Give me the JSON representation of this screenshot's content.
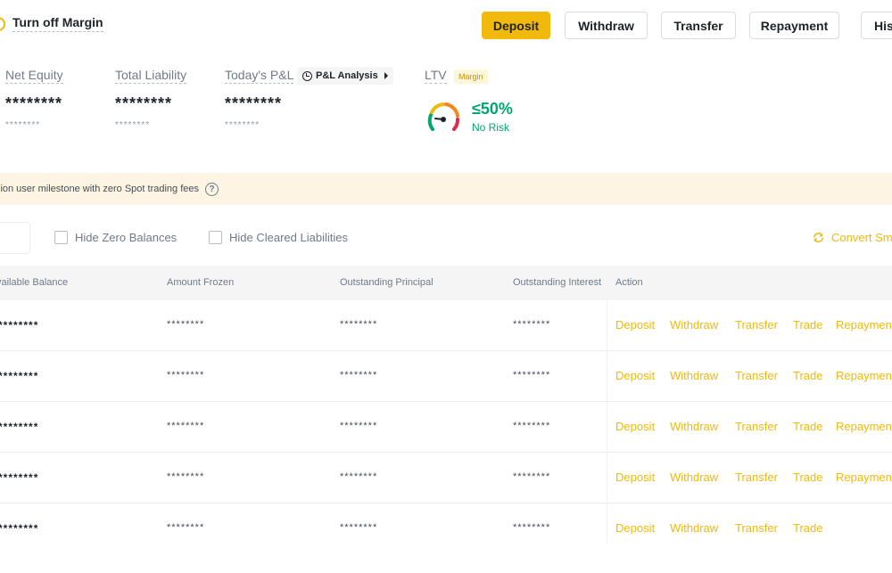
{
  "header": {
    "toggle_label": "Turn off Margin",
    "buttons": {
      "deposit": "Deposit",
      "withdraw": "Withdraw",
      "transfer": "Transfer",
      "repayment": "Repayment",
      "history": "His"
    }
  },
  "stats": {
    "net_equity": {
      "label": "Net Equity",
      "value": "********",
      "sub": "********"
    },
    "total_liability": {
      "label": "Total Liability",
      "value": "********",
      "sub": "********"
    },
    "todays_pnl": {
      "label": "Today's P&L",
      "value": "********",
      "sub": "********"
    },
    "pnl_analysis": "P&L Analysis",
    "ltv": {
      "label": "LTV",
      "badge": "Margin",
      "value": "≤50%",
      "risk": "No Risk"
    }
  },
  "colors": {
    "accent": "#f0b90b",
    "positive": "#03a66d",
    "banner_bg": "#fdf4e3"
  },
  "banner": {
    "text": "lion user milestone with zero Spot trading fees",
    "help_icon": "?"
  },
  "filters": {
    "hide_zero_balances": "Hide Zero Balances",
    "hide_cleared_liabilities": "Hide Cleared Liabilities",
    "convert": "Convert Sm"
  },
  "table": {
    "columns": [
      "vailable Balance",
      "Amount Frozen",
      "Outstanding Principal",
      "Outstanding Interest",
      "Action"
    ],
    "rows": [
      {
        "balance": "********",
        "frozen": "********",
        "principal": "********",
        "interest": "********",
        "actions": [
          "Deposit",
          "Withdraw",
          "Transfer",
          "Trade",
          "Repaymen"
        ]
      },
      {
        "balance": "********",
        "frozen": "********",
        "principal": "********",
        "interest": "********",
        "actions": [
          "Deposit",
          "Withdraw",
          "Transfer",
          "Trade",
          "Repaymen"
        ]
      },
      {
        "balance": "********",
        "frozen": "********",
        "principal": "********",
        "interest": "********",
        "actions": [
          "Deposit",
          "Withdraw",
          "Transfer",
          "Trade",
          "Repaymen"
        ]
      },
      {
        "balance": "********",
        "frozen": "********",
        "principal": "********",
        "interest": "********",
        "actions": [
          "Deposit",
          "Withdraw",
          "Transfer",
          "Trade",
          "Repaymen"
        ]
      },
      {
        "balance": "********",
        "frozen": "********",
        "principal": "********",
        "interest": "********",
        "actions": [
          "Deposit",
          "Withdraw",
          "Transfer",
          "Trade"
        ]
      }
    ]
  }
}
